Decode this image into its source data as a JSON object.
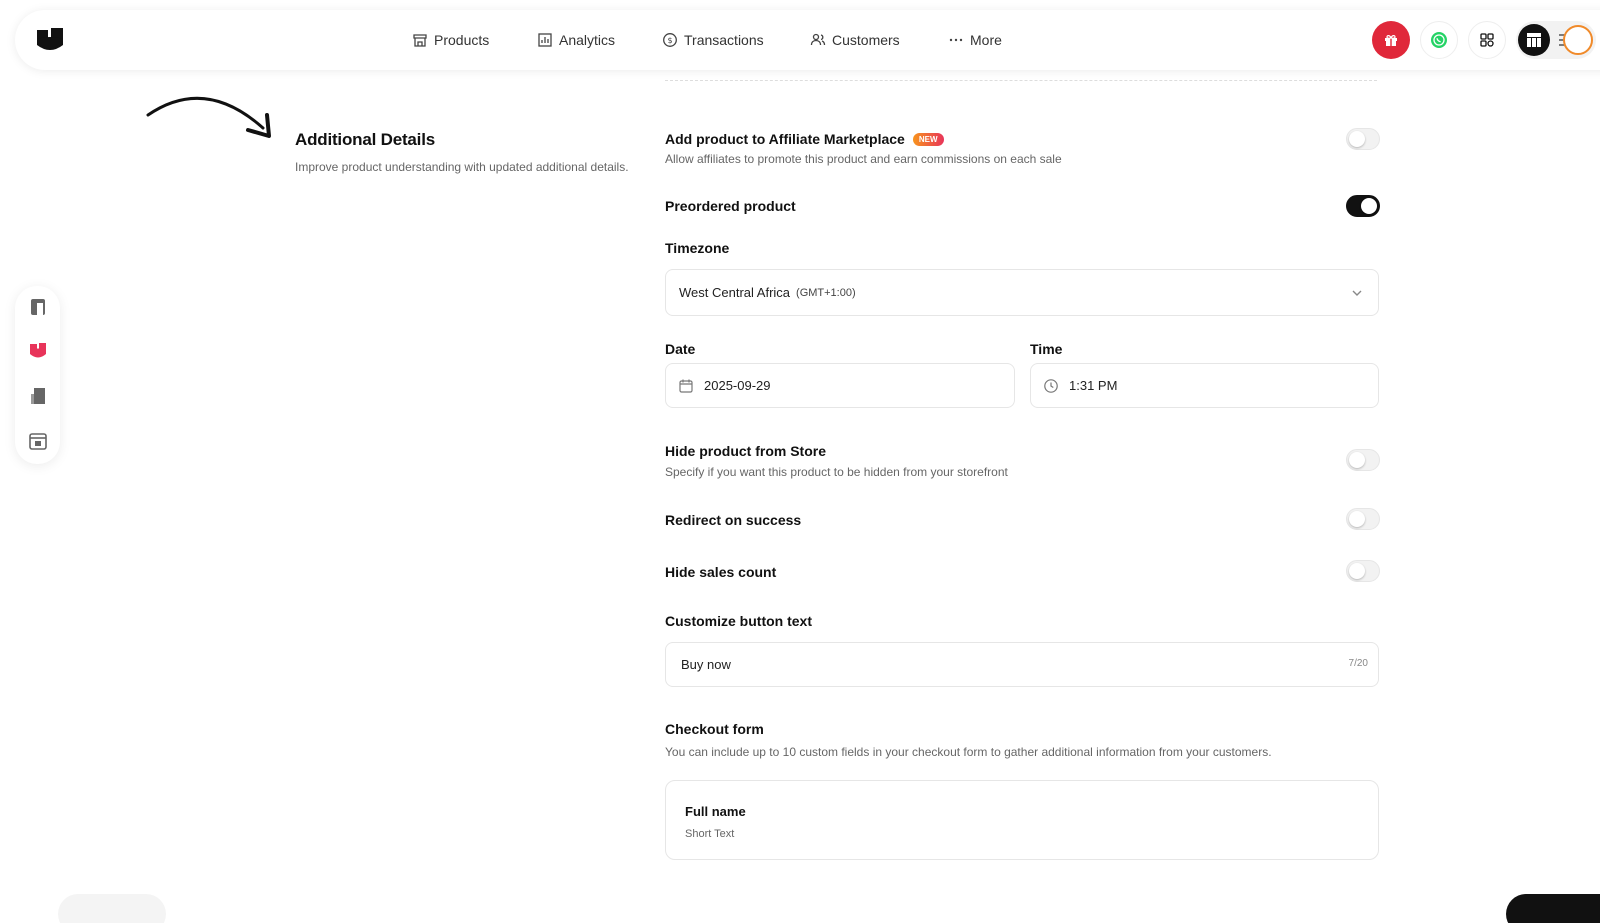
{
  "nav": {
    "items": [
      {
        "label": "Products",
        "icon": "store-icon"
      },
      {
        "label": "Analytics",
        "icon": "chart-icon"
      },
      {
        "label": "Transactions",
        "icon": "dollar-circle-icon"
      },
      {
        "label": "Customers",
        "icon": "users-icon"
      },
      {
        "label": "More",
        "icon": "ellipsis-icon"
      }
    ]
  },
  "section": {
    "title": "Additional Details",
    "description": "Improve product understanding with updated additional details."
  },
  "affiliate": {
    "title": "Add product to Affiliate Marketplace",
    "badge": "NEW",
    "description": "Allow affiliates to promote this product and earn commissions on each sale",
    "enabled": false
  },
  "preorder": {
    "title": "Preordered product",
    "enabled": true
  },
  "timezone": {
    "label": "Timezone",
    "value": "West Central Africa",
    "offset": "(GMT+1:00)"
  },
  "date": {
    "label": "Date",
    "value": "2025-09-29"
  },
  "time": {
    "label": "Time",
    "value": "1:31 PM"
  },
  "hide_product": {
    "title": "Hide product from Store",
    "description": "Specify if you want this product to be hidden from your storefront",
    "enabled": false
  },
  "redirect": {
    "title": "Redirect on success",
    "enabled": false
  },
  "hide_sales": {
    "title": "Hide sales count",
    "enabled": false
  },
  "button_text": {
    "label": "Customize button text",
    "value": "Buy now",
    "counter": "7/20"
  },
  "checkout": {
    "title": "Checkout form",
    "description": "You can include up to 10 custom fields in your checkout form to gather additional information from your customers.",
    "fields": [
      {
        "name": "Full name",
        "type": "Short Text"
      }
    ]
  },
  "colors": {
    "accent": "#111111",
    "gift": "#e0283a",
    "whatsapp": "#25d366",
    "badge_from": "#f7941d",
    "badge_to": "#e8345a"
  }
}
